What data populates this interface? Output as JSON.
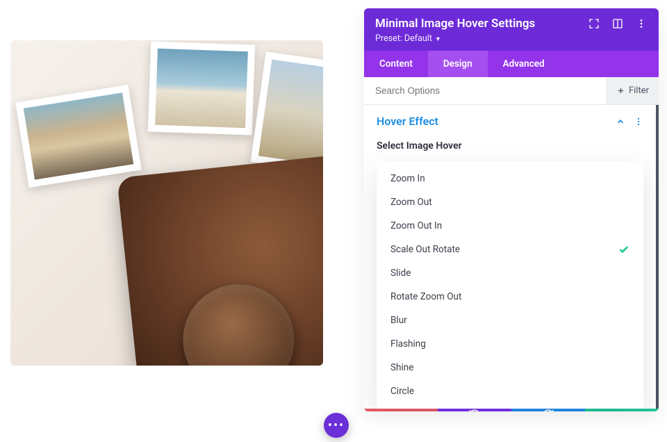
{
  "panel": {
    "title": "Minimal Image Hover Settings",
    "preset_label": "Preset: Default",
    "tabs": [
      "Content",
      "Design",
      "Advanced"
    ],
    "active_tab": 1,
    "search_placeholder": "Search Options",
    "filter_label": "Filter",
    "section_title": "Hover Effect",
    "field_label": "Select Image Hover",
    "options": [
      "Zoom In",
      "Zoom Out",
      "Zoom Out In",
      "Scale Out Rotate",
      "Slide",
      "Rotate Zoom Out",
      "Blur",
      "Flashing",
      "Shine",
      "Circle"
    ],
    "selected_index": 3
  }
}
